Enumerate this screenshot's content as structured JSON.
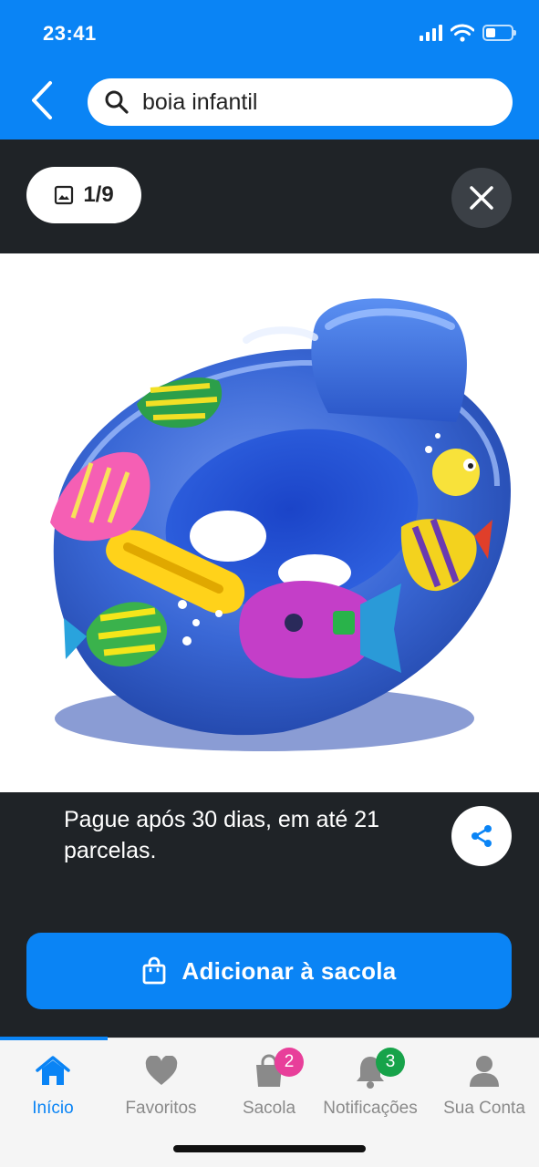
{
  "status_bar": {
    "time": "23:41"
  },
  "search": {
    "value": "boia infantil"
  },
  "gallery": {
    "counter": "1/9"
  },
  "product": {
    "image_desc": "inflatable baby float",
    "payment_text": "Pague após 30 dias, em até 21 parcelas."
  },
  "actions": {
    "add_to_bag_label": "Adicionar à sacola"
  },
  "tabbar": {
    "items": [
      {
        "label": "Início",
        "icon": "home-icon",
        "active": true
      },
      {
        "label": "Favoritos",
        "icon": "heart-icon"
      },
      {
        "label": "Sacola",
        "icon": "bag-icon",
        "badge": "2",
        "badge_color": "#e83f9a"
      },
      {
        "label": "Notificações",
        "icon": "bell-icon",
        "badge": "3",
        "badge_color": "#17a34a"
      },
      {
        "label": "Sua Conta",
        "icon": "user-icon"
      }
    ]
  },
  "colors": {
    "brand": "#0a84f5",
    "dark_bg": "#1f2327",
    "inactive": "#8a8a8a"
  }
}
